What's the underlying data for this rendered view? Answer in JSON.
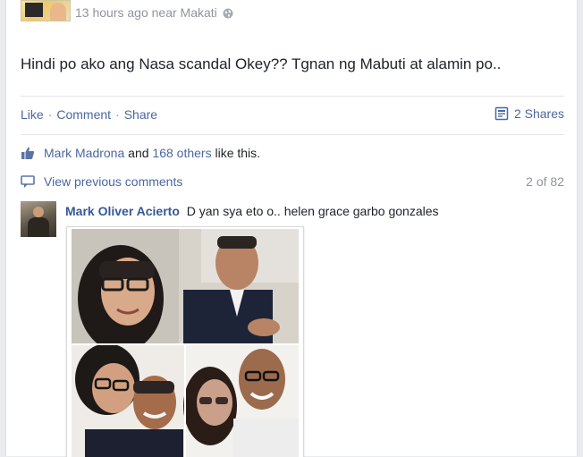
{
  "post": {
    "meta_text": "13 hours ago near Makati",
    "body": "Hindi po ako ang Nasa scandal Okey?? Tgnan ng Mabuti at alamin po.."
  },
  "actions": {
    "like": "Like",
    "separator": "·",
    "comment": "Comment",
    "share": "Share",
    "shares_count": "2 Shares"
  },
  "likes": {
    "name": "Mark Madrona",
    "and": "and",
    "others": "168 others",
    "suffix": "like this."
  },
  "comments": {
    "view_previous": "View previous comments",
    "page_count": "2 of 82",
    "items": [
      {
        "author": "Mark Oliver Acierto",
        "text": "D yan sya eto o.. helen grace garbo gonzales"
      }
    ]
  },
  "colors": {
    "link": "#4b67a1",
    "author": "#365899",
    "muted": "#90949c"
  },
  "icons": [
    "globe-icon",
    "share-doc-icon",
    "thumbs-up-icon",
    "comment-bubble-icon"
  ]
}
